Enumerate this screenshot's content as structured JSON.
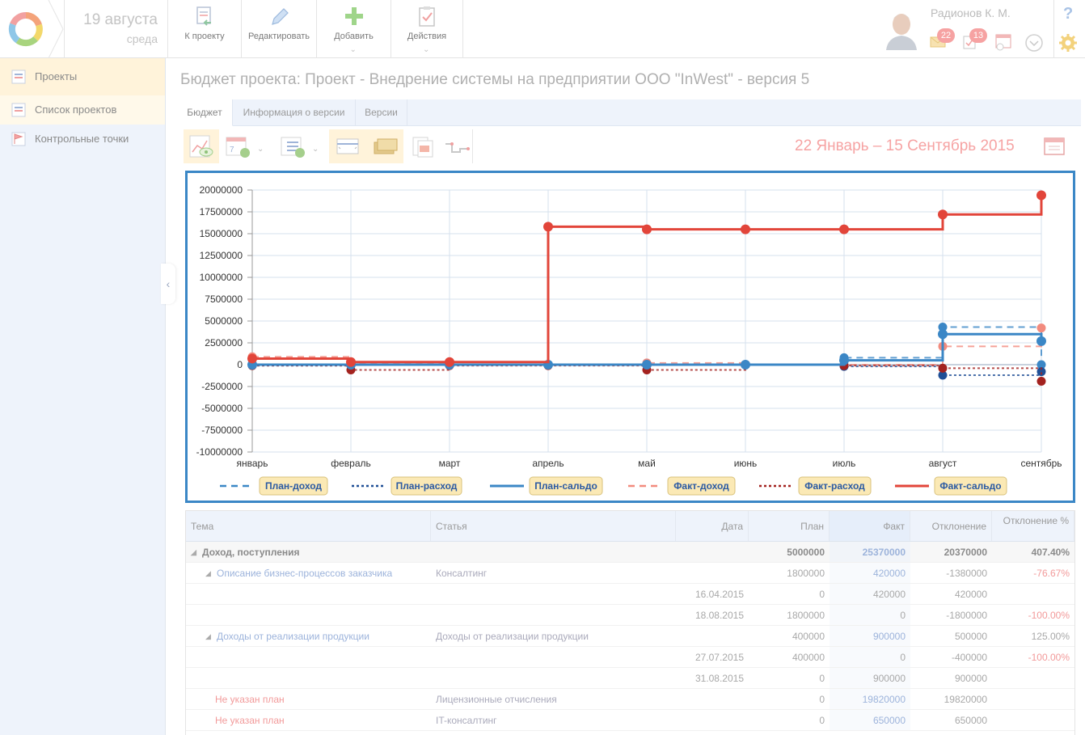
{
  "header": {
    "date": "19 августа",
    "weekday": "среда",
    "buttons": [
      {
        "label": "К проекту",
        "icon": "back-to-project-icon"
      },
      {
        "label": "Редактировать",
        "icon": "pencil-icon"
      },
      {
        "label": "Добавить",
        "icon": "plus-icon"
      },
      {
        "label": "Действия",
        "icon": "clipboard-check-icon"
      }
    ],
    "user": "Радионов К. М.",
    "mail_count": "22",
    "tasks_count": "13",
    "help": "?"
  },
  "sidebar": {
    "items": [
      {
        "label": "Проекты",
        "active": true
      },
      {
        "label": "Список проектов"
      },
      {
        "label": "Контрольные точки"
      }
    ]
  },
  "page": {
    "title": "Бюджет проекта: Проект - Внедрение системы на предприятии ООО \"InWest\" - версия 5",
    "tabs": [
      "Бюджет",
      "Информация о версии",
      "Версии"
    ],
    "period": "22 Январь – 15 Сентябрь 2015"
  },
  "colors": {
    "plan": "#3b87c6",
    "plan_expense": "#1f4f96",
    "fact": "#e2453a",
    "fact_income": "#f28b7e",
    "fact_expense": "#a3221f",
    "accent_border": "#3b87c6"
  },
  "chart_data": {
    "type": "line",
    "step": true,
    "categories": [
      "январь",
      "февраль",
      "март",
      "апрель",
      "май",
      "июнь",
      "июль",
      "август",
      "сентябрь"
    ],
    "ylim": [
      -10000000,
      20000000
    ],
    "yticks": [
      "20000000",
      "17500000",
      "15000000",
      "12500000",
      "10000000",
      "7500000",
      "5000000",
      "2500000",
      "0",
      "-2500000",
      "-5000000",
      "-7500000",
      "-10000000"
    ],
    "grid": true,
    "legend_position": "bottom",
    "series": [
      {
        "name": "План-доход",
        "style": "dashed",
        "values": [
          0,
          0,
          0,
          0,
          0,
          0,
          800000,
          4300000,
          0
        ]
      },
      {
        "name": "План-расход",
        "style": "dotted",
        "values": [
          -100000,
          0,
          0,
          0,
          0,
          0,
          -200000,
          -1200000,
          -800000
        ]
      },
      {
        "name": "План-сальдо",
        "style": "solid",
        "values": [
          0,
          0,
          0,
          0,
          0,
          0,
          500000,
          3500000,
          2700000
        ]
      },
      {
        "name": "Факт-доход",
        "style": "dashed",
        "values": [
          900000,
          200000,
          300000,
          0,
          200000,
          0,
          0,
          2100000,
          4200000
        ]
      },
      {
        "name": "Факт-расход",
        "style": "dotted",
        "values": [
          -100000,
          -600000,
          -100000,
          -100000,
          -600000,
          0,
          -100000,
          -400000,
          -1900000
        ]
      },
      {
        "name": "Факт-сальдо",
        "style": "solid",
        "values": [
          700000,
          300000,
          300000,
          15800000,
          15500000,
          15500000,
          15500000,
          17200000,
          19400000
        ]
      }
    ]
  },
  "table": {
    "headers": [
      "Тема",
      "Статья",
      "Дата",
      "План",
      "Факт",
      "Отклонение",
      "Отклонение %"
    ],
    "rows": [
      {
        "kind": "group",
        "theme": "Доход, поступления",
        "article": "",
        "date": "",
        "plan": "5000000",
        "fact": "25370000",
        "dev": "20370000",
        "devp": "407.40%"
      },
      {
        "kind": "sub",
        "theme": "Описание бизнес-процессов заказчика",
        "article": "Консалтинг",
        "date": "",
        "plan": "1800000",
        "fact": "420000",
        "dev": "-1380000",
        "devp": "-76.67%"
      },
      {
        "kind": "item",
        "theme": "",
        "article": "",
        "date": "16.04.2015",
        "plan": "0",
        "fact": "420000",
        "dev": "420000",
        "devp": ""
      },
      {
        "kind": "item",
        "theme": "",
        "article": "",
        "date": "18.08.2015",
        "plan": "1800000",
        "fact": "0",
        "dev": "-1800000",
        "devp": "-100.00%"
      },
      {
        "kind": "sub",
        "theme": "Доходы от реализации продукции",
        "article": "Доходы от реализации продукции",
        "date": "",
        "plan": "400000",
        "fact": "900000",
        "dev": "500000",
        "devp": "125.00%"
      },
      {
        "kind": "item",
        "theme": "",
        "article": "",
        "date": "27.07.2015",
        "plan": "400000",
        "fact": "0",
        "dev": "-400000",
        "devp": "-100.00%"
      },
      {
        "kind": "item",
        "theme": "",
        "article": "",
        "date": "31.08.2015",
        "plan": "0",
        "fact": "900000",
        "dev": "900000",
        "devp": ""
      },
      {
        "kind": "noplan",
        "theme": "Не указан план",
        "article": "Лицензионные отчисления",
        "date": "",
        "plan": "0",
        "fact": "19820000",
        "dev": "19820000",
        "devp": ""
      },
      {
        "kind": "noplan",
        "theme": "Не указан план",
        "article": "IT-консалтинг",
        "date": "",
        "plan": "0",
        "fact": "650000",
        "dev": "650000",
        "devp": ""
      }
    ]
  }
}
